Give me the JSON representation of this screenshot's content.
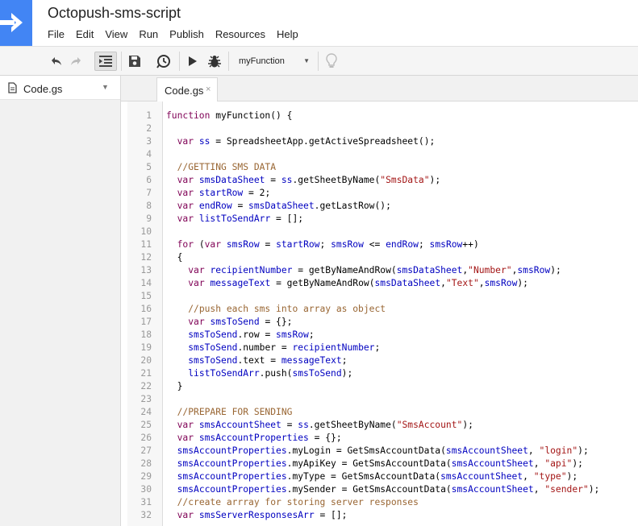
{
  "app": {
    "title": "Octopush-sms-script",
    "menu": [
      "File",
      "Edit",
      "View",
      "Run",
      "Publish",
      "Resources",
      "Help"
    ]
  },
  "toolbar": {
    "buttons": [
      "undo-icon",
      "redo-icon",
      "indent-icon",
      "save-icon",
      "triggers-clock-icon",
      "run-icon",
      "debug-bug-icon",
      "lightbulb-icon"
    ],
    "selected_function": "myFunction"
  },
  "sidebar": {
    "file_name": "Code.gs"
  },
  "editor": {
    "tab_label": "Code.gs",
    "tab_close": "×",
    "line_numbers": [
      "1",
      "2",
      "3",
      "4",
      "5",
      "6",
      "7",
      "8",
      "9",
      "10",
      "11",
      "12",
      "13",
      "14",
      "15",
      "16",
      "17",
      "18",
      "19",
      "20",
      "21",
      "22",
      "23",
      "24",
      "25",
      "26",
      "27",
      "28",
      "29",
      "30",
      "31",
      "32"
    ],
    "code_lines": [
      "function myFunction() {",
      "",
      "  var ss = SpreadsheetApp.getActiveSpreadsheet();",
      "",
      "  //GETTING SMS DATA",
      "  var smsDataSheet = ss.getSheetByName(\"SmsData\");",
      "  var startRow = 2;",
      "  var endRow = smsDataSheet.getLastRow();",
      "  var listToSendArr = [];",
      "",
      "  for (var smsRow = startRow; smsRow <= endRow; smsRow++)",
      "  {",
      "    var recipientNumber = getByNameAndRow(smsDataSheet,\"Number\",smsRow);",
      "    var messageText = getByNameAndRow(smsDataSheet,\"Text\",smsRow);",
      "",
      "    //push each sms into array as object",
      "    var smsToSend = {};",
      "    smsToSend.row = smsRow;",
      "    smsToSend.number = recipientNumber;",
      "    smsToSend.text = messageText;",
      "    listToSendArr.push(smsToSend);",
      "  }",
      "",
      "  //PREPARE FOR SENDING",
      "  var smsAccountSheet = ss.getSheetByName(\"SmsAccount\");",
      "  var smsAccountProperties = {};",
      "  smsAccountProperties.myLogin = GetSmsAccountData(smsAccountSheet, \"login\");",
      "  smsAccountProperties.myApiKey = GetSmsAccountData(smsAccountSheet, \"api\");",
      "  smsAccountProperties.myType = GetSmsAccountData(smsAccountSheet, \"type\");",
      "  smsAccountProperties.mySender = GetSmsAccountData(smsAccountSheet, \"sender\");",
      "  //create arrray for storing server responses",
      "  var smsServerResponsesArr = [];"
    ],
    "syntax_colors": {
      "keyword": "#7f0055",
      "variable": "#0000c0",
      "string": "#a31515",
      "comment": "#996633"
    }
  }
}
